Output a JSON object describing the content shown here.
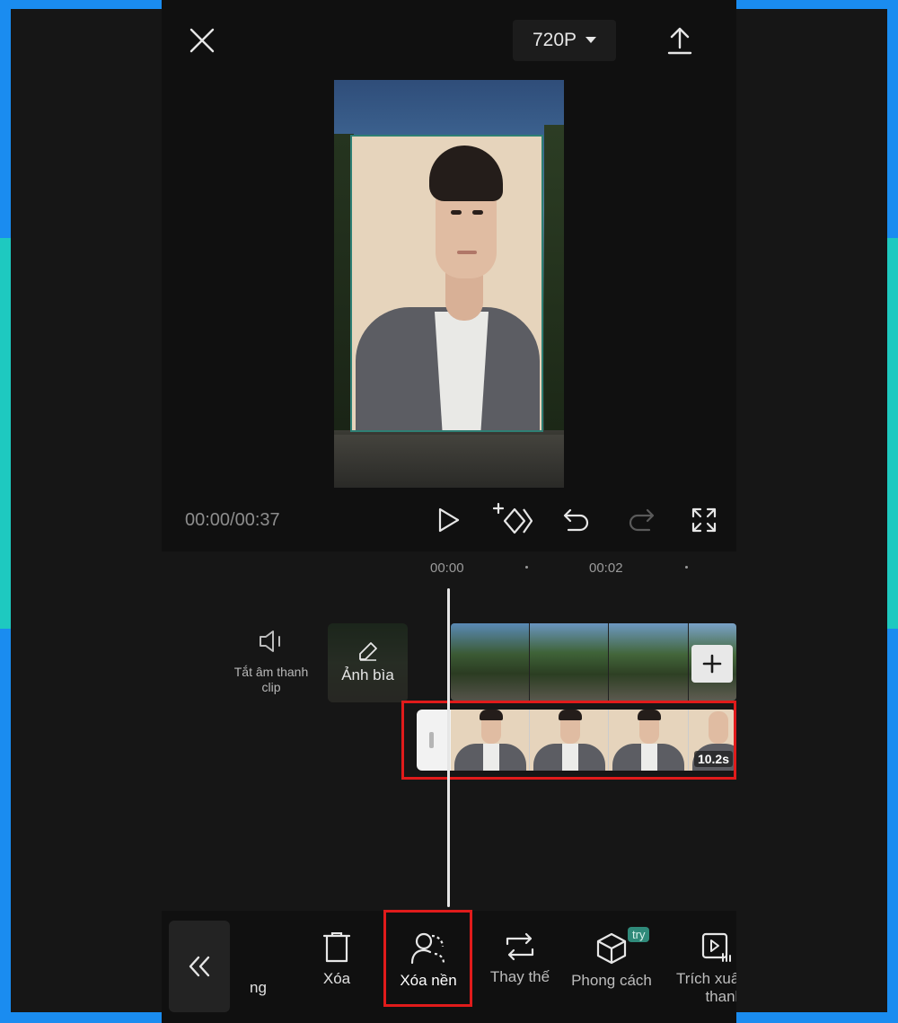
{
  "header": {
    "resolution": "720P"
  },
  "preview": {
    "timecode": "00:00/00:37"
  },
  "ruler": {
    "ticks": [
      "00:00",
      "00:02"
    ]
  },
  "tracks": {
    "mute_label": "Tắt âm thanh clip",
    "cover_label": "Ảnh bìa",
    "clip_duration": "10.2s"
  },
  "toolbar": {
    "partial_left_label": "ng",
    "items": [
      {
        "label": "Xóa"
      },
      {
        "label": "Xóa nền"
      },
      {
        "label": "Thay thế"
      },
      {
        "label": "Phong cách",
        "badge": "try"
      },
      {
        "label": "Trích xuất thanh"
      }
    ]
  },
  "colors": {
    "frame_blue": "#1a8cf0",
    "frame_teal": "#1ec9c0",
    "frame_pink": "#e8248c",
    "highlight_red": "#e01b1b",
    "badge_teal": "#2f8a7a"
  }
}
